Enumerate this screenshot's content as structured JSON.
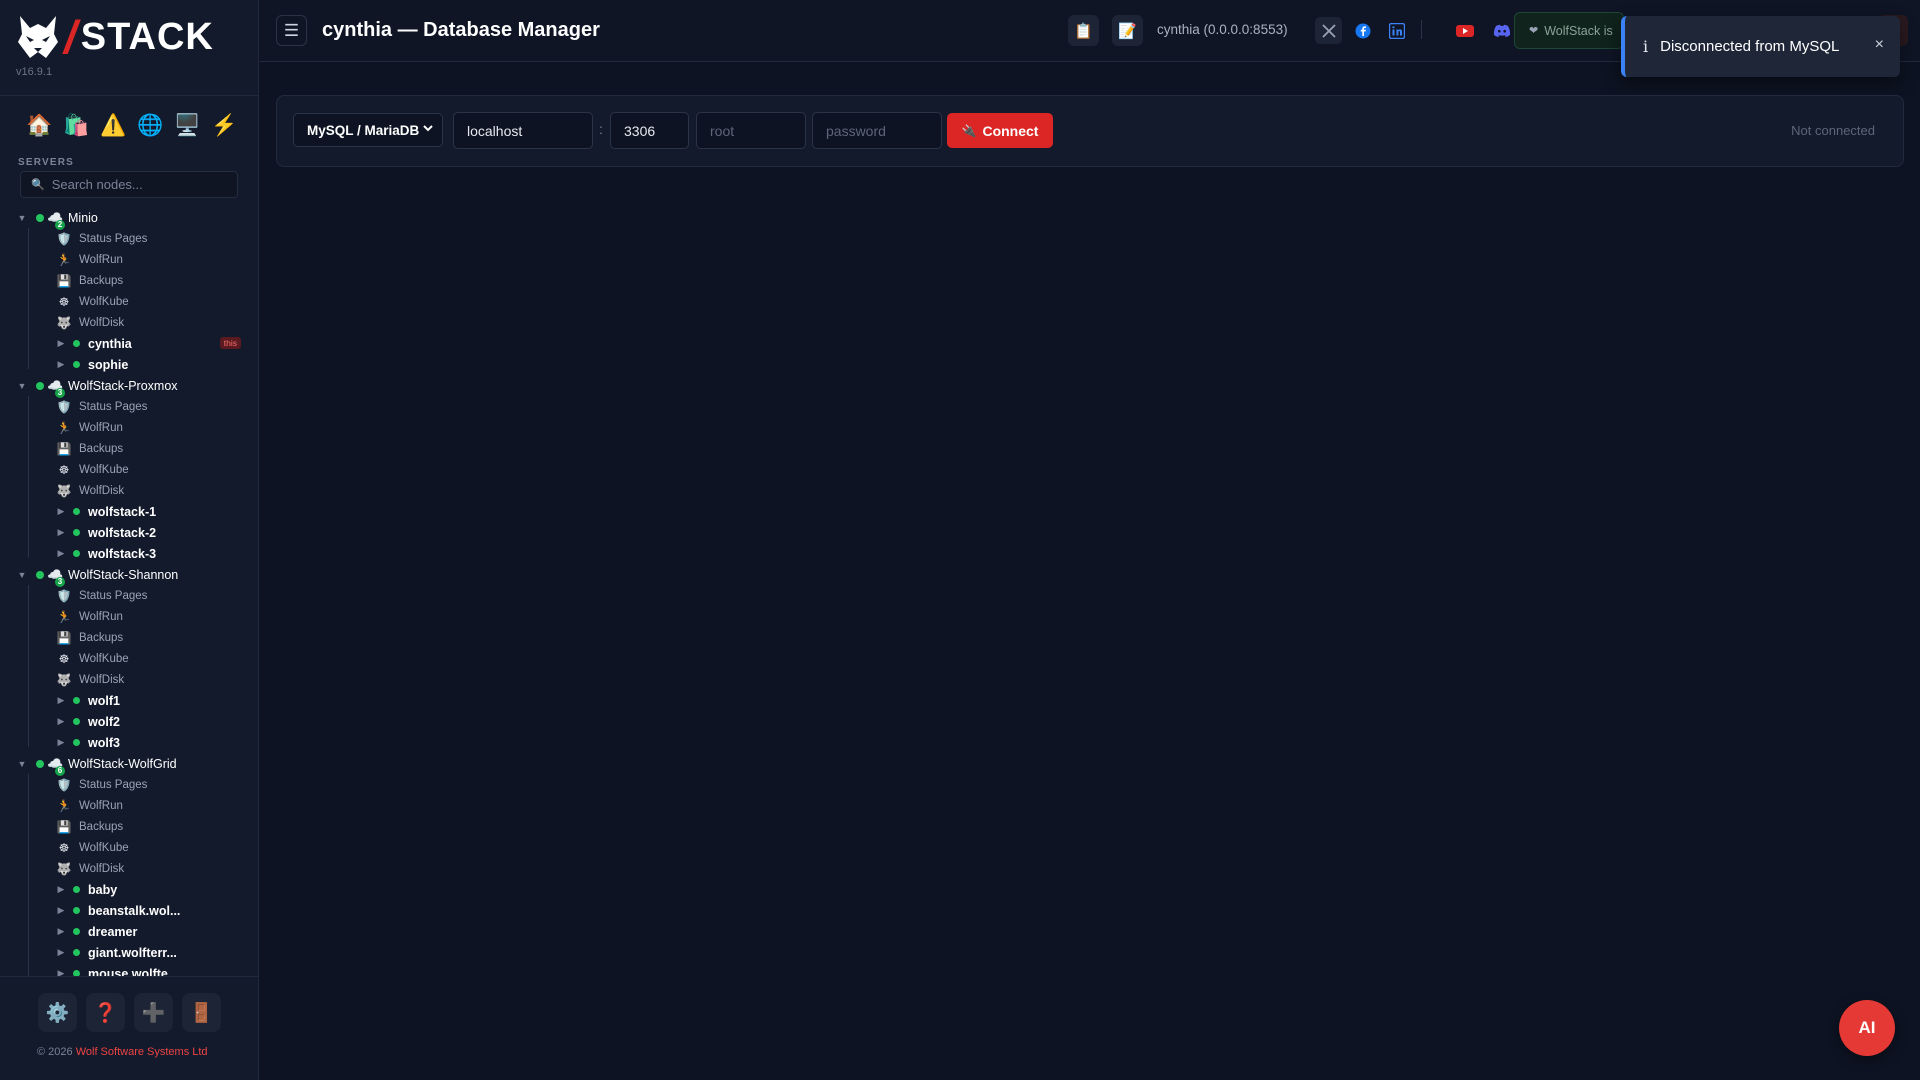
{
  "app": {
    "logo_text": "STACK",
    "logo_slash": "/",
    "version": "v16.9.1",
    "brand_color": "#dc2626"
  },
  "sidebar": {
    "quick_icons": [
      {
        "name": "home-icon",
        "glyph": "🏠"
      },
      {
        "name": "shopping-bags-icon",
        "glyph": "🛍️"
      },
      {
        "name": "warning-icon",
        "glyph": "⚠️"
      },
      {
        "name": "globe-icon",
        "glyph": "🌐"
      },
      {
        "name": "desktop-icon",
        "glyph": "🖥️"
      },
      {
        "name": "lightning-icon",
        "glyph": "⚡"
      }
    ],
    "servers_label": "SERVERS",
    "search_placeholder": "Search nodes...",
    "clusters": [
      {
        "name": "Minio",
        "count": "2",
        "items": [
          {
            "icon": "🛡️",
            "icon_name": "shield-icon",
            "label": "Status Pages"
          },
          {
            "icon": "🏃",
            "icon_name": "runner-icon",
            "label": "WolfRun"
          },
          {
            "icon": "💾",
            "icon_name": "floppy-disk-icon",
            "label": "Backups"
          },
          {
            "icon": "☸",
            "icon_name": "helm-icon",
            "label": "WolfKube"
          },
          {
            "icon": "🐺",
            "icon_name": "wolf-icon",
            "label": "WolfDisk"
          }
        ],
        "nodes": [
          {
            "name": "cynthia",
            "badge": "this"
          },
          {
            "name": "sophie"
          }
        ]
      },
      {
        "name": "WolfStack-Proxmox",
        "count": "3",
        "items": [
          {
            "icon": "🛡️",
            "icon_name": "shield-icon",
            "label": "Status Pages"
          },
          {
            "icon": "🏃",
            "icon_name": "runner-icon",
            "label": "WolfRun"
          },
          {
            "icon": "💾",
            "icon_name": "floppy-disk-icon",
            "label": "Backups"
          },
          {
            "icon": "☸",
            "icon_name": "helm-icon",
            "label": "WolfKube"
          },
          {
            "icon": "🐺",
            "icon_name": "wolf-icon",
            "label": "WolfDisk"
          }
        ],
        "nodes": [
          {
            "name": "wolfstack-1"
          },
          {
            "name": "wolfstack-2"
          },
          {
            "name": "wolfstack-3"
          }
        ]
      },
      {
        "name": "WolfStack-Shannon",
        "count": "3",
        "items": [
          {
            "icon": "🛡️",
            "icon_name": "shield-icon",
            "label": "Status Pages"
          },
          {
            "icon": "🏃",
            "icon_name": "runner-icon",
            "label": "WolfRun"
          },
          {
            "icon": "💾",
            "icon_name": "floppy-disk-icon",
            "label": "Backups"
          },
          {
            "icon": "☸",
            "icon_name": "helm-icon",
            "label": "WolfKube"
          },
          {
            "icon": "🐺",
            "icon_name": "wolf-icon",
            "label": "WolfDisk"
          }
        ],
        "nodes": [
          {
            "name": "wolf1"
          },
          {
            "name": "wolf2"
          },
          {
            "name": "wolf3"
          }
        ]
      },
      {
        "name": "WolfStack-WolfGrid",
        "count": "6",
        "items": [
          {
            "icon": "🛡️",
            "icon_name": "shield-icon",
            "label": "Status Pages"
          },
          {
            "icon": "🏃",
            "icon_name": "runner-icon",
            "label": "WolfRun"
          },
          {
            "icon": "💾",
            "icon_name": "floppy-disk-icon",
            "label": "Backups"
          },
          {
            "icon": "☸",
            "icon_name": "helm-icon",
            "label": "WolfKube"
          },
          {
            "icon": "🐺",
            "icon_name": "wolf-icon",
            "label": "WolfDisk"
          }
        ],
        "nodes": [
          {
            "name": "baby"
          },
          {
            "name": "beanstalk.wol..."
          },
          {
            "name": "dreamer"
          },
          {
            "name": "giant.wolfterr..."
          },
          {
            "name": "mouse.wolfte..."
          }
        ]
      }
    ],
    "footer_buttons": [
      {
        "name": "settings-button",
        "glyph": "⚙️"
      },
      {
        "name": "help-button",
        "glyph": "❓"
      },
      {
        "name": "add-server-button",
        "glyph": "➕"
      },
      {
        "name": "logout-button",
        "glyph": "🚪"
      }
    ],
    "copyright_prefix": "© 2026 ",
    "copyright_company": "Wolf Software Systems Ltd"
  },
  "header": {
    "menu_glyph": "☰",
    "title": "cynthia — Database Manager",
    "clipboard_glyph": "📋",
    "notes_glyph": "📝",
    "node_info": "cynthia (0.0.0.0:8553)",
    "update_pill_text": "WolfStack is",
    "update_heart": "❤"
  },
  "toast": {
    "icon": "i",
    "message": "Disconnected from MySQL",
    "close_glyph": "×"
  },
  "connection": {
    "db_type": "MySQL / MariaDB",
    "host": "localhost",
    "port": "3306",
    "user_placeholder": "root",
    "password_placeholder": "password",
    "colon": ":",
    "connect_label": "Connect",
    "connect_glyph": "🔌",
    "status": "Not connected"
  },
  "ai_button": "AI",
  "colors": {
    "background": "#0d1322",
    "sidebar": "#131a2b",
    "accent_red": "#dc2626",
    "online_green": "#22c55e",
    "toast_blue": "#3b82f6"
  }
}
